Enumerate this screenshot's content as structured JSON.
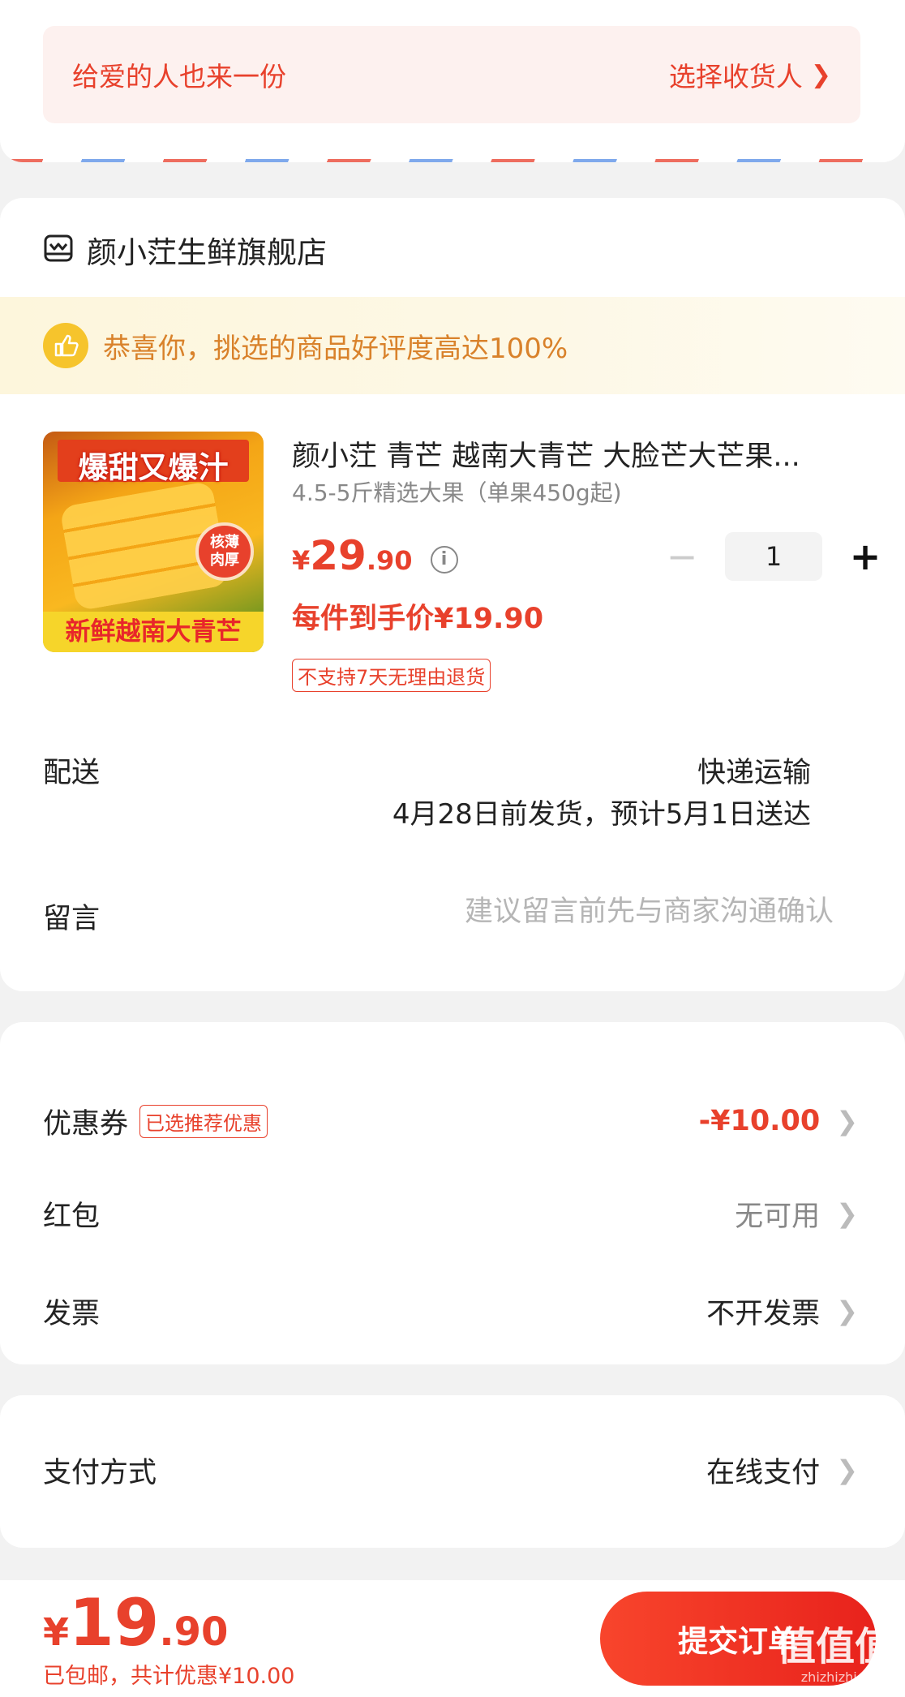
{
  "gift": {
    "text": "给爱的人也来一份",
    "action": "选择收货人"
  },
  "store": {
    "name": "颜小茳生鲜旗舰店",
    "icon": "store-icon"
  },
  "promo": {
    "text": "恭喜你，挑选的商品好评度高达100%",
    "icon": "thumbs-up-icon"
  },
  "product": {
    "image_text_top": "爆甜又爆汁",
    "image_badge_1": "核薄",
    "image_badge_2": "肉厚",
    "image_text_bottom": "新鲜越南大青芒",
    "title": "颜小茳 青芒 越南大青芒 大脸芒大芒果...",
    "spec": "4.5-5斤精选大果（单果450g起)",
    "price_currency": "¥",
    "price_int": "29",
    "price_dec": ".90",
    "info_icon": "i",
    "quantity": "1",
    "minus": "−",
    "plus": "+",
    "final_price": "每件到手价¥19.90",
    "return_policy": "不支持7天无理由退货"
  },
  "shipping": {
    "label": "配送",
    "method": "快递运输",
    "date": "4月28日前发货，预计5月1日送达"
  },
  "message": {
    "label": "留言",
    "placeholder": "建议留言前先与商家沟通确认"
  },
  "coupon": {
    "label": "优惠券",
    "tag": "已选推荐优惠",
    "value": "-¥10.00"
  },
  "redpacket": {
    "label": "红包",
    "value": "无可用"
  },
  "invoice": {
    "label": "发票",
    "value": "不开发票"
  },
  "payment": {
    "label": "支付方式",
    "value": "在线支付"
  },
  "bottom": {
    "currency": "¥",
    "total_int": "19",
    "total_dec": ".90",
    "note": "已包邮，共计优惠¥10.00",
    "submit": "提交订单",
    "watermark": "值值值",
    "watermark_sub": "zhizhizhi.com"
  },
  "colors": {
    "accent": "#e8412c",
    "promo": "#d9822b"
  }
}
